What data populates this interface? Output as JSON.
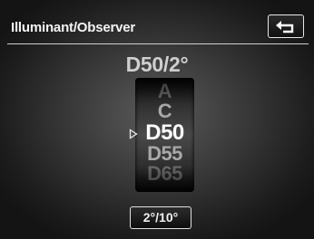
{
  "header": {
    "title": "Illuminant/Observer",
    "back_icon": "return-arrow-icon"
  },
  "current_setting": "D50/2°",
  "illuminant_picker": {
    "items": [
      "A",
      "C",
      "D50",
      "D55",
      "D65"
    ],
    "selected": "D50",
    "marker_icon": "triangle-right-outline-icon"
  },
  "observer_button": {
    "label": "2°/10°"
  },
  "colors": {
    "background_center": "#5a5a5a",
    "background_edge": "#141414",
    "text": "#ffffff",
    "divider": "#d0d0d0"
  }
}
